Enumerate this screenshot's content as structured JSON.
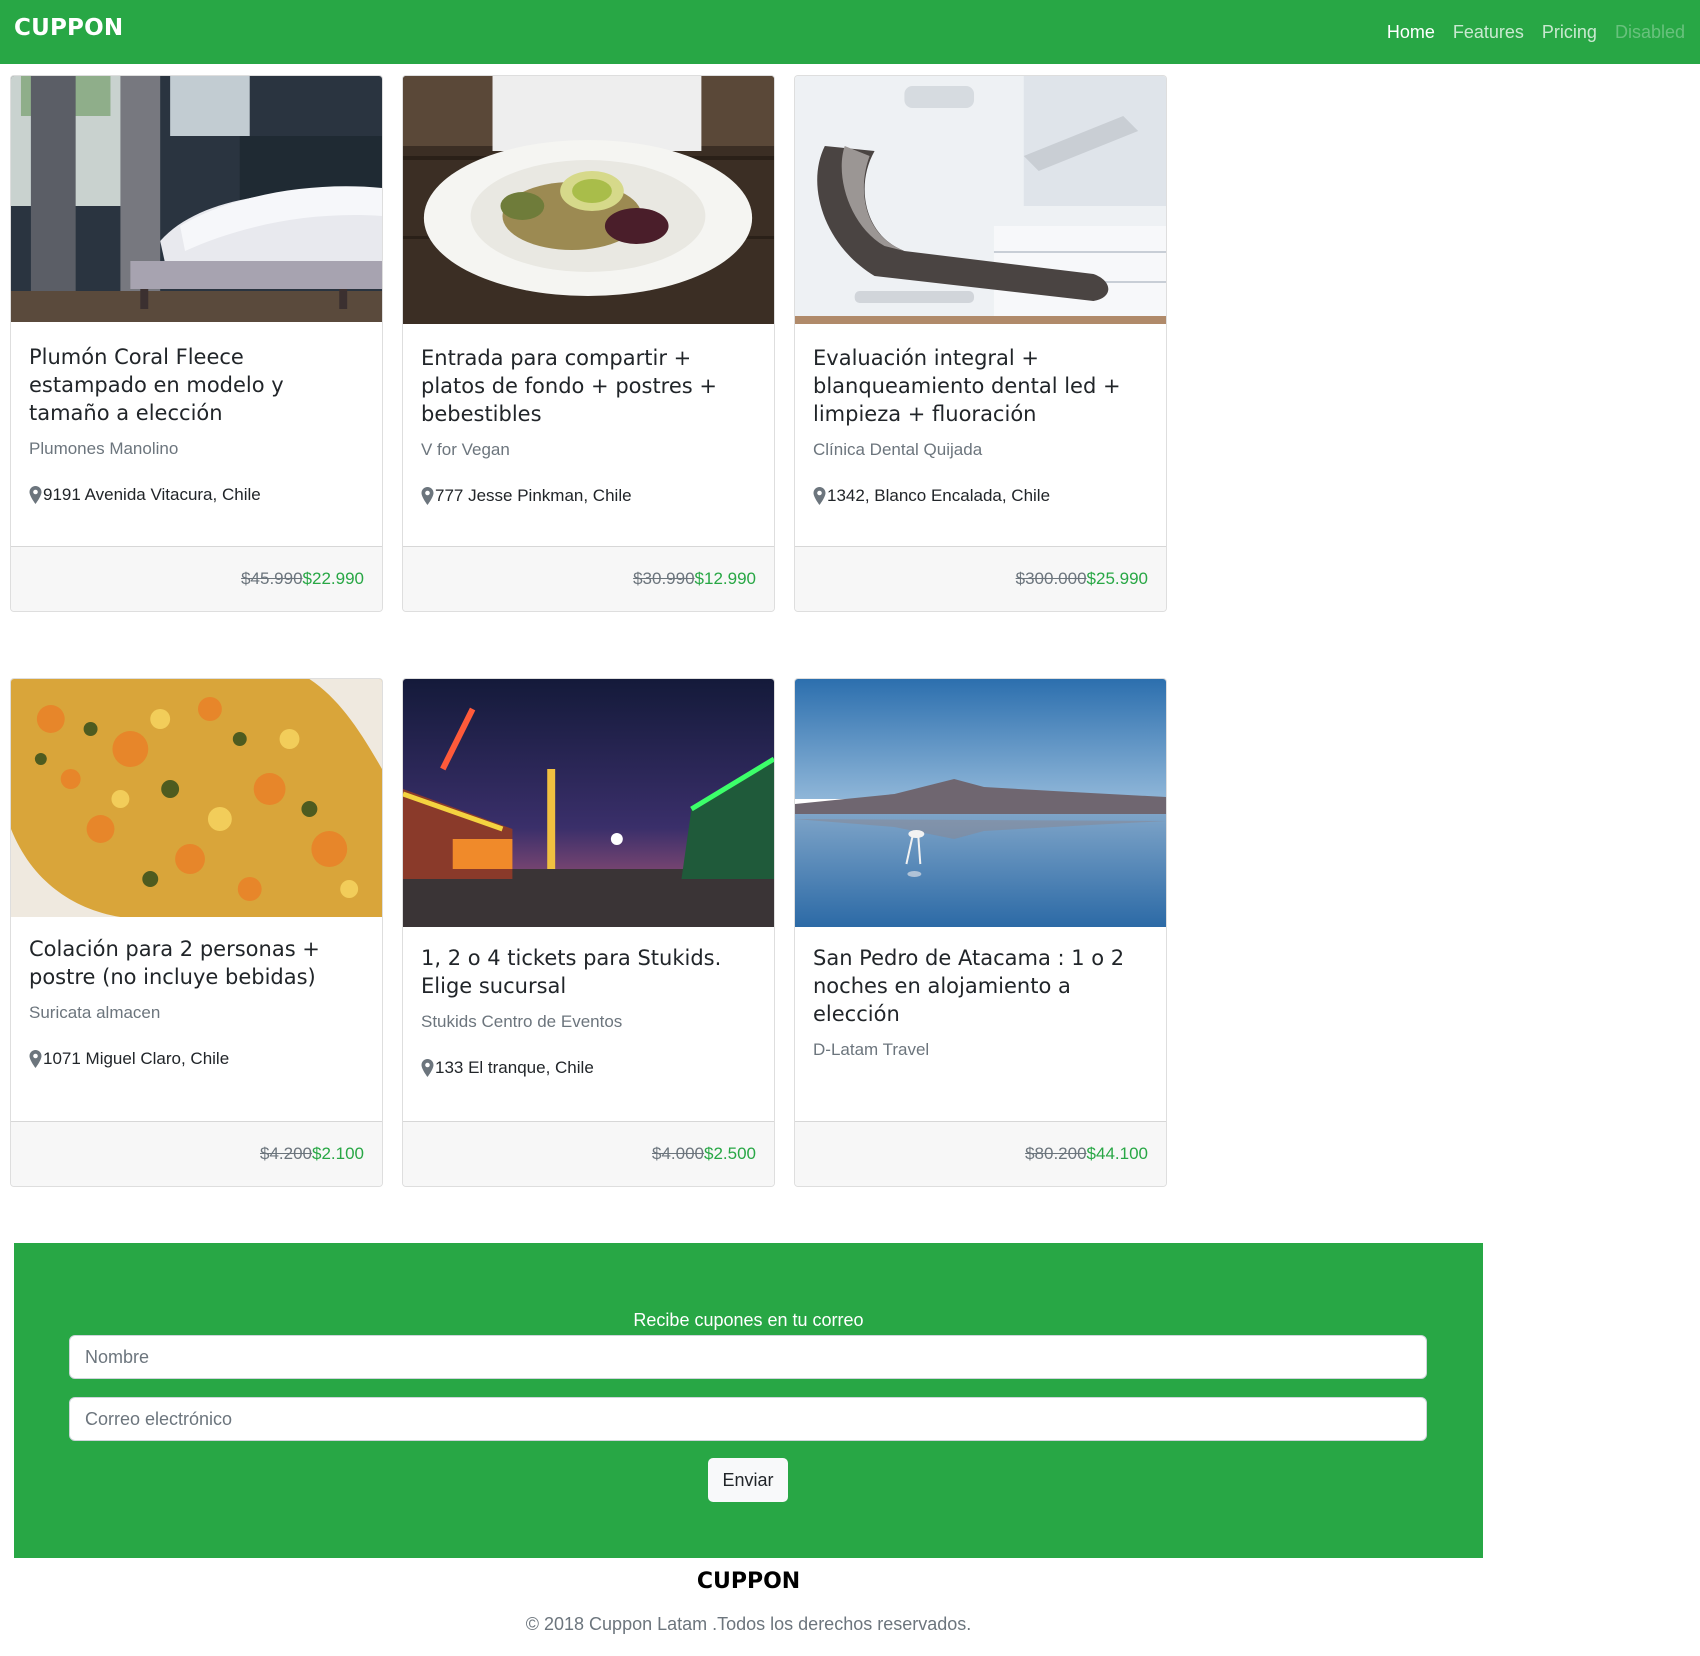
{
  "nav": {
    "brand": "CUPPON",
    "links": [
      "Home",
      "Features",
      "Pricing",
      "Disabled"
    ]
  },
  "cards": [
    {
      "title": "Plumón Coral Fleece estampado en modelo y tamaño a elección",
      "merchant": "Plumones Manolino",
      "location": "9191 Avenida Vitacura, Chile",
      "old_price": "$45.990",
      "new_price": "$22.990",
      "image": "bedroom-photo"
    },
    {
      "title": "Entrada para compartir + platos de fondo + postres + bebestibles",
      "merchant": "V for Vegan",
      "location": "777 Jesse Pinkman, Chile",
      "old_price": "$30.990",
      "new_price": "$12.990",
      "image": "vegan-salad-photo"
    },
    {
      "title": "Evaluación integral + blanqueamiento dental led + limpieza + fluoración",
      "merchant": "Clínica Dental Quijada",
      "location": "1342, Blanco Encalada, Chile",
      "old_price": "$300.000",
      "new_price": "$25.990",
      "image": "dental-chair-photo"
    },
    {
      "title": "Colación para 2 personas + postre (no incluye bebidas)",
      "merchant": "Suricata almacen",
      "location": "1071 Miguel Claro, Chile",
      "old_price": "$4.200",
      "new_price": "$2.100",
      "image": "vegetable-stew-photo"
    },
    {
      "title": "1, 2 o 4 tickets para Stukids. Elige sucursal",
      "merchant": "Stukids Centro de Eventos",
      "location": "133 El tranque, Chile",
      "old_price": "$4.000",
      "new_price": "$2.500",
      "image": "fair-at-night-photo"
    },
    {
      "title": "San Pedro de Atacama : 1 o 2 noches en alojamiento a elección",
      "merchant": "D-Latam Travel",
      "location": "",
      "old_price": "$80.200",
      "new_price": "$44.100",
      "image": "flamingo-lagoon-photo"
    }
  ],
  "subscribe": {
    "title": "Recibe cupones en tu correo",
    "name_placeholder": "Nombre",
    "email_placeholder": "Correo electrónico",
    "button": "Enviar"
  },
  "footer": {
    "brand": "CUPPON",
    "copyright": "© 2018 Cuppon Latam .Todos los derechos reservados."
  },
  "colors": {
    "brand_green": "#28a745",
    "footer_bg": "#f7f7f7"
  }
}
